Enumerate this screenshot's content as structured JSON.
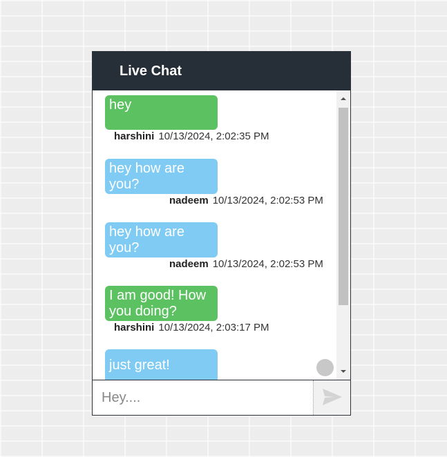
{
  "header": {
    "title": "Live Chat"
  },
  "messages": [
    {
      "text": "hey",
      "sender": "harshini",
      "timestamp": "10/13/2024, 2:02:35 PM",
      "color": "#5cc160"
    },
    {
      "text": "hey how are you?",
      "sender": "nadeem",
      "timestamp": "10/13/2024, 2:02:53 PM",
      "color": "#7fcbf3"
    },
    {
      "text": "hey how are you?",
      "sender": "nadeem",
      "timestamp": "10/13/2024, 2:02:53 PM",
      "color": "#7fcbf3"
    },
    {
      "text": "I am good! How you doing?",
      "sender": "harshini",
      "timestamp": "10/13/2024, 2:03:17 PM",
      "color": "#5cc160"
    },
    {
      "text": "just great!",
      "color": "#7fcbf3"
    }
  ],
  "input": {
    "placeholder": "Hey....",
    "value": ""
  },
  "send_icon": "send-icon",
  "colors": {
    "header_bg": "#262f37",
    "own_bubble": "#5cc160",
    "other_bubble": "#7fcbf3"
  }
}
